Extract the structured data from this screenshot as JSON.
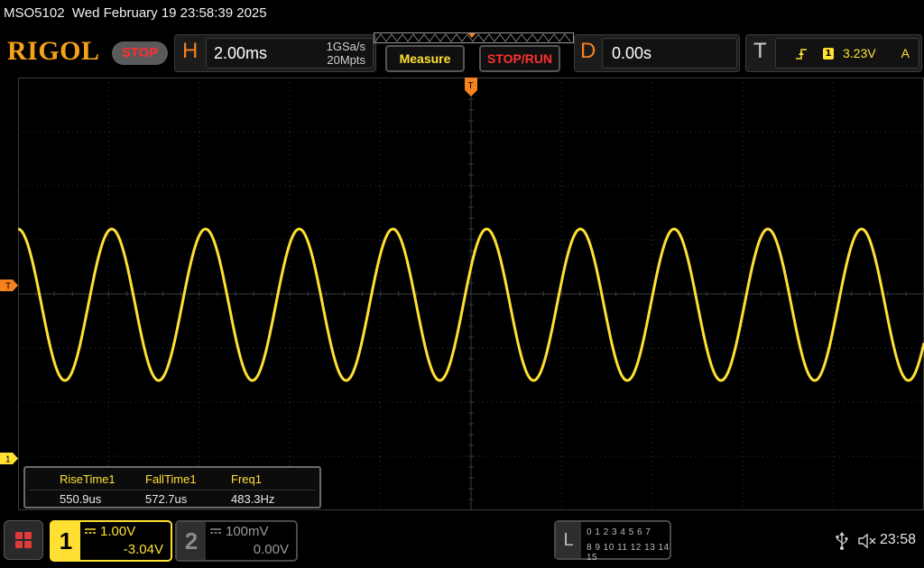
{
  "titlebar": {
    "model": "MSO5102",
    "datetime": "Wed February 19 23:58:39 2025"
  },
  "header": {
    "logo": "RIGOL",
    "run_state": "STOP",
    "horizontal": {
      "letter": "H",
      "timebase": "2.00ms",
      "sample_rate": "1GSa/s",
      "memory_depth": "20Mpts"
    },
    "measure_label": "Measure",
    "stoprun_label": "STOP/RUN",
    "delay": {
      "letter": "D",
      "value": "0.00s"
    },
    "trigger": {
      "letter": "T",
      "source": "1",
      "level": "3.23V",
      "mode": "A"
    }
  },
  "markers": {
    "trigger_level": "T",
    "channel1": "1",
    "trigger_position": "T"
  },
  "measurements": {
    "items": [
      {
        "name": "RiseTime1",
        "value": "550.9us"
      },
      {
        "name": "FallTime1",
        "value": "572.7us"
      },
      {
        "name": "Freq1",
        "value": "483.3Hz"
      }
    ]
  },
  "channels": {
    "ch1": {
      "number": "1",
      "scale": "1.00V",
      "offset": "-3.04V"
    },
    "ch2": {
      "number": "2",
      "scale": "100mV",
      "offset": "0.00V"
    }
  },
  "logic": {
    "letter": "L",
    "row1": "0 1 2 3   4 5 6 7",
    "row2": "8 9 10 11 12 13 14 15"
  },
  "status": {
    "time": "23:58"
  },
  "colors": {
    "trace": "#ffe033",
    "accent_orange": "#f5821f",
    "logo": "#f5a21a",
    "stop_red": "#ff3030",
    "grid": "#3a3a3a"
  },
  "waveform": {
    "frequency_hz": 483.3,
    "timebase_per_div_ms": 2.0,
    "divisions_horizontal": 10,
    "divisions_vertical": 8,
    "volts_per_div": 1.0,
    "peak_to_peak_divs": 2.8,
    "center_div_above_screen_center": -0.2,
    "start_phase_deg": 90
  }
}
